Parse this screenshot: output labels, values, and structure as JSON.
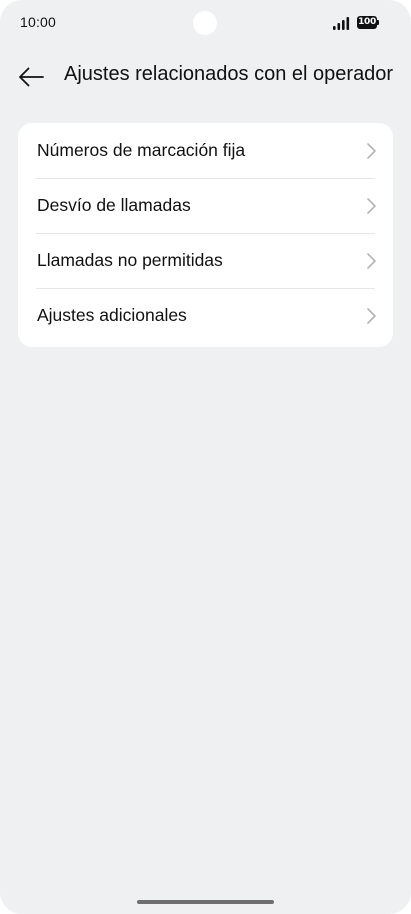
{
  "status_bar": {
    "time": "10:00",
    "battery": "100"
  },
  "header": {
    "title": "Ajustes relacionados con el operador"
  },
  "settings": {
    "items": [
      {
        "label": "Números de marcación fija"
      },
      {
        "label": "Desvío de llamadas"
      },
      {
        "label": "Llamadas no permitidas"
      },
      {
        "label": "Ajustes adicionales"
      }
    ]
  },
  "icons": {
    "back": "arrow-left-icon",
    "chevron": "chevron-right-icon",
    "signal": "signal-icon",
    "battery": "battery-icon"
  },
  "colors": {
    "background": "#eff0f2",
    "card": "#ffffff",
    "text": "#111111",
    "chevron": "#b5b5b8"
  }
}
